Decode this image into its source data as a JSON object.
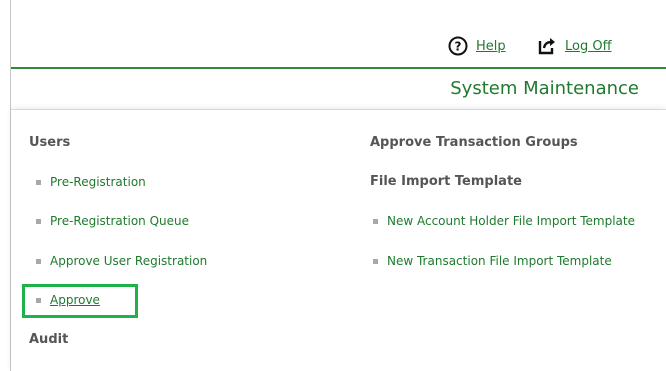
{
  "top_bar": {
    "help_label": "Help",
    "logoff_label": "Log Off",
    "accent_color": "#2e8b3a"
  },
  "header": {
    "title": "System Maintenance"
  },
  "left_column": {
    "users_heading": "Users",
    "items": [
      {
        "label": "Pre-Registration"
      },
      {
        "label": "Pre-Registration Queue"
      },
      {
        "label": "Approve User Registration"
      },
      {
        "label": "Approve",
        "highlighted": true
      }
    ],
    "audit_heading": "Audit"
  },
  "right_column": {
    "approve_heading": "Approve Transaction Groups",
    "file_import_heading": "File Import Template",
    "items": [
      {
        "label": "New Account Holder File Import Template"
      },
      {
        "label": "New Transaction File Import Template"
      }
    ]
  },
  "colors": {
    "link_green": "#1f7a2e",
    "highlight_green": "#1db34a",
    "heading_gray": "#555555"
  }
}
